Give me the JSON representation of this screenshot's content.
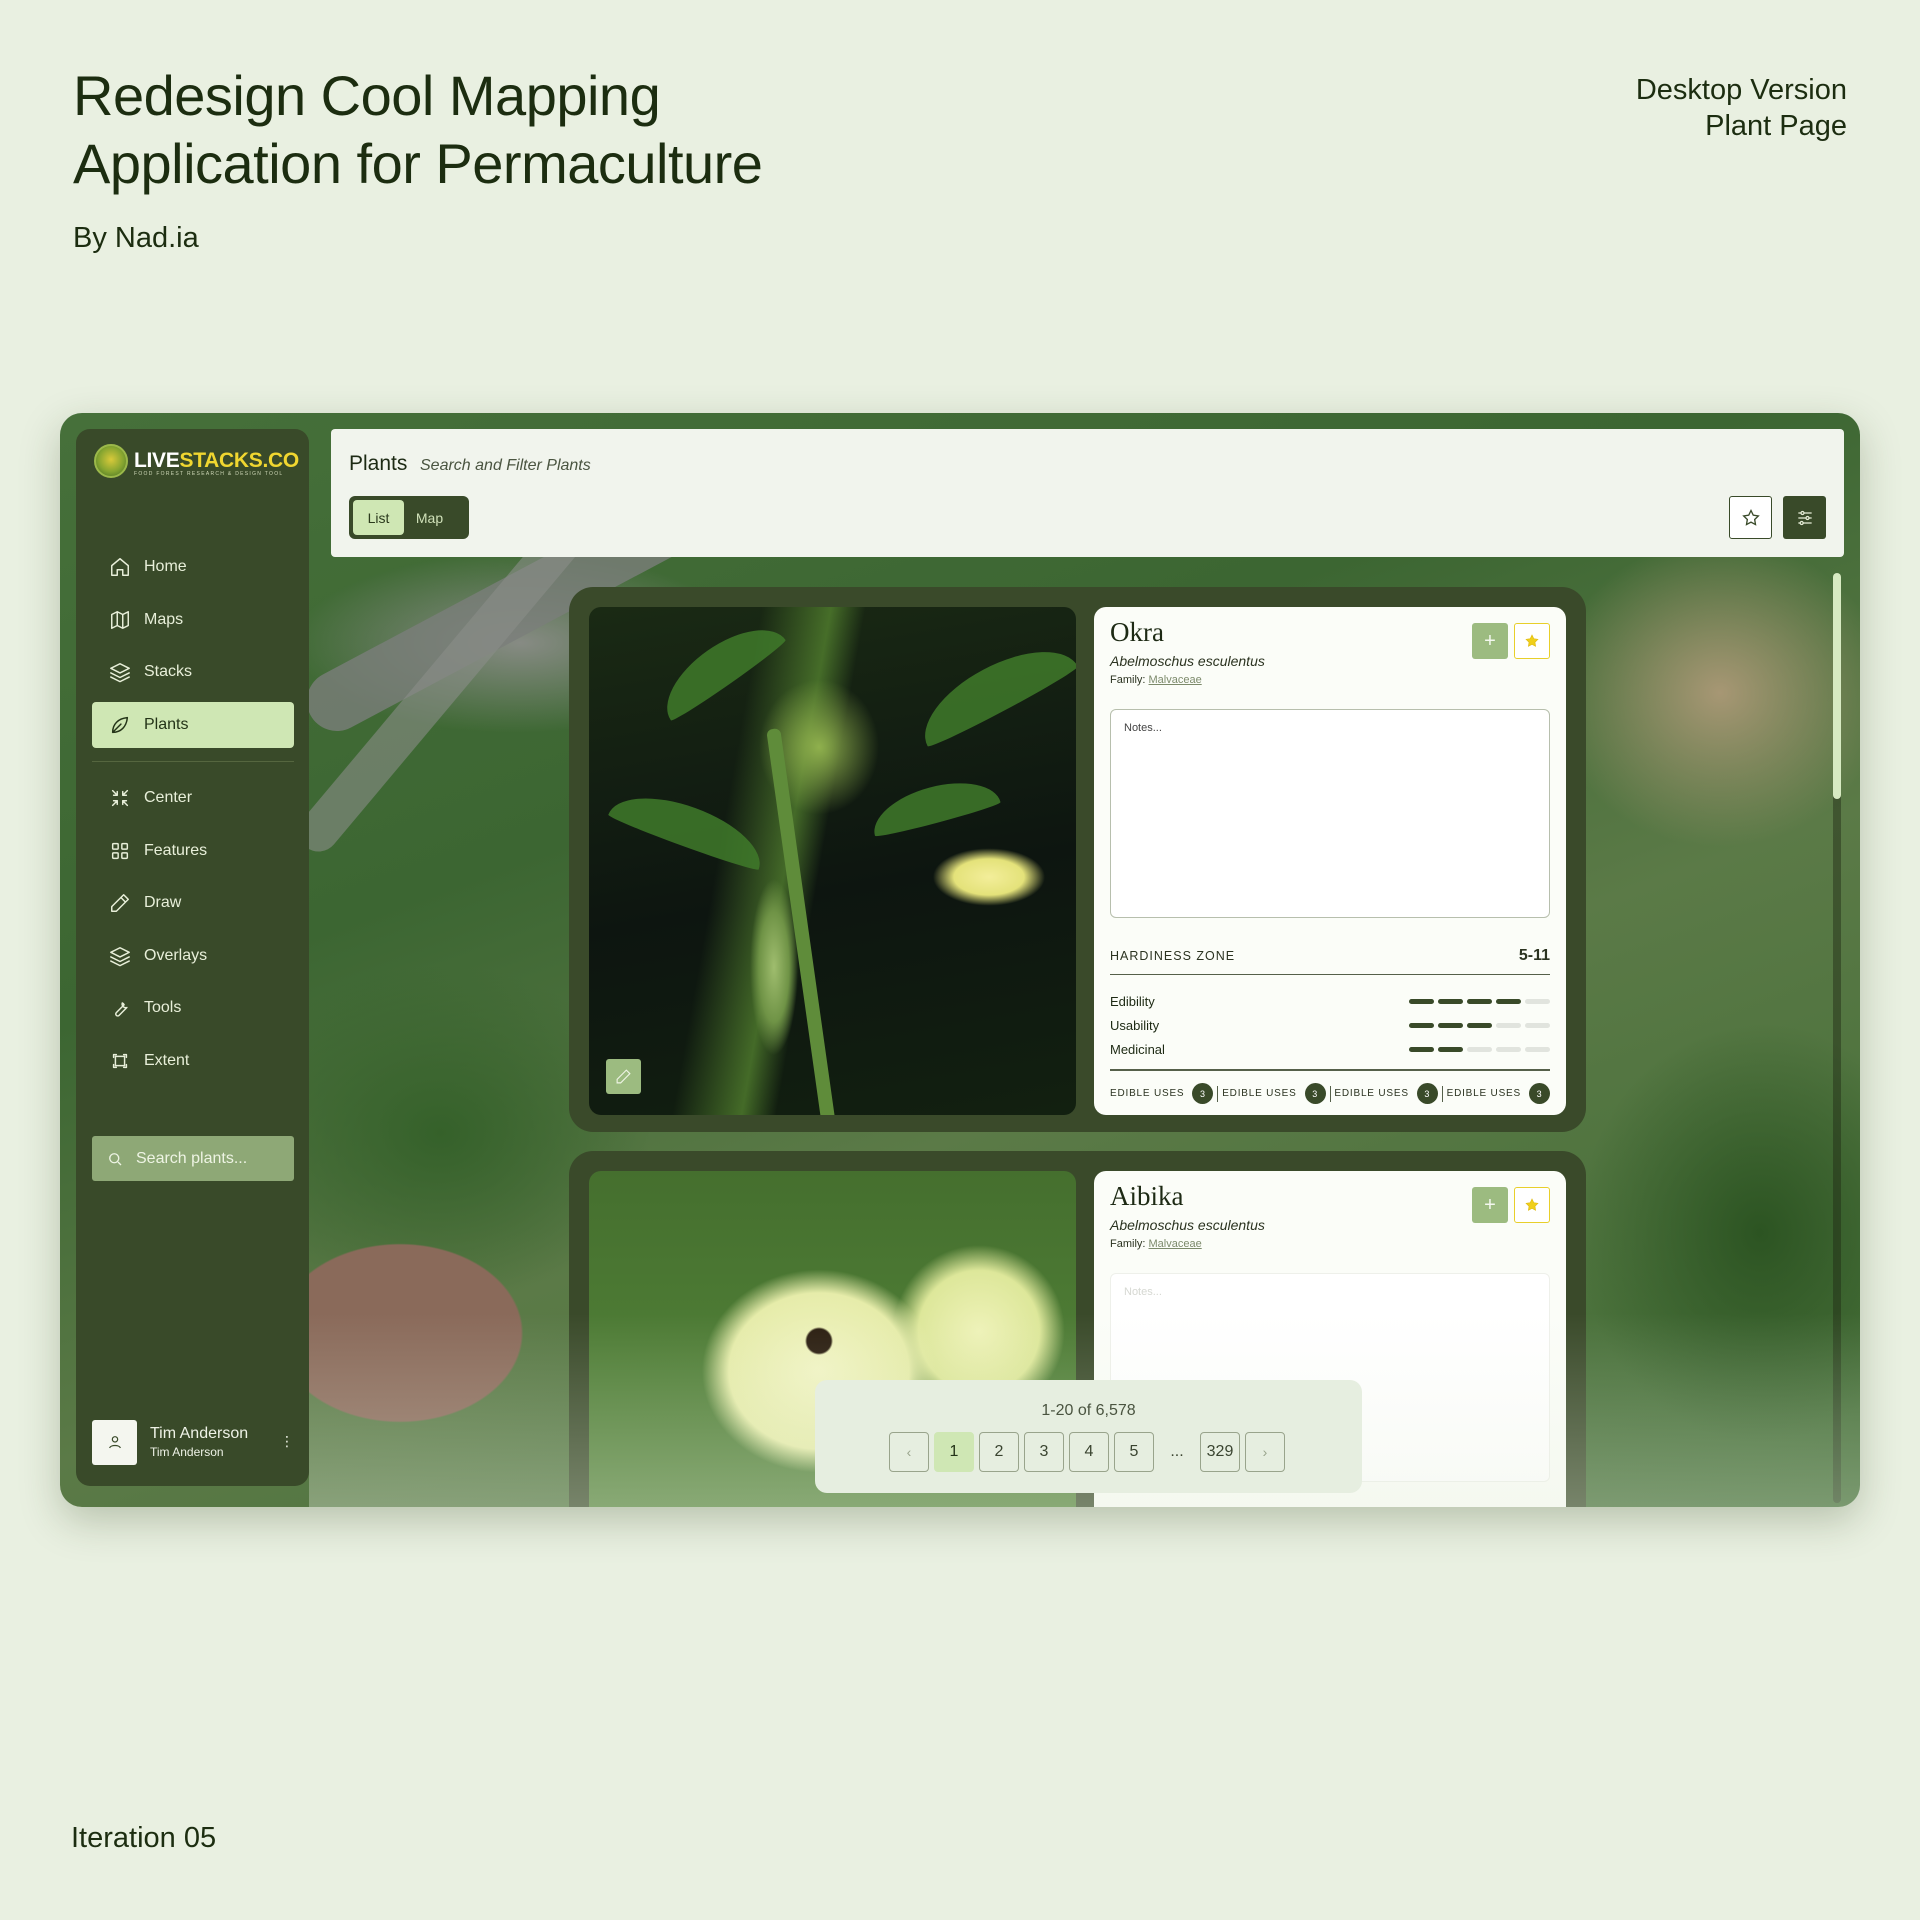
{
  "presentation": {
    "title_line1": "Redesign Cool Mapping",
    "title_line2": "Application for Permaculture",
    "author": "By Nad.ia",
    "meta_line1": "Desktop Version",
    "meta_line2": "Plant Page",
    "iteration": "Iteration 05"
  },
  "app": {
    "logo": {
      "text_a": "LIVE",
      "text_b": "STACKS.CO",
      "tagline": "FOOD FOREST RESEARCH & DESIGN TOOL"
    },
    "sidebar": {
      "group1": [
        {
          "label": "Home",
          "icon": "home-icon"
        },
        {
          "label": "Maps",
          "icon": "map-icon"
        },
        {
          "label": "Stacks",
          "icon": "layers-icon"
        },
        {
          "label": "Plants",
          "icon": "leaf-icon",
          "active": true
        }
      ],
      "group2": [
        {
          "label": "Center",
          "icon": "center-icon"
        },
        {
          "label": "Features",
          "icon": "grid-icon"
        },
        {
          "label": "Draw",
          "icon": "pencil-icon"
        },
        {
          "label": "Overlays",
          "icon": "layers-icon"
        },
        {
          "label": "Tools",
          "icon": "wrench-icon"
        },
        {
          "label": "Extent",
          "icon": "extent-icon"
        }
      ],
      "search_placeholder": "Search plants...",
      "user": {
        "name": "Tim Anderson",
        "sub": "Tim Anderson",
        "more": "⋮"
      }
    },
    "header": {
      "title": "Plants",
      "subtitle": "Search and Filter Plants",
      "toggle": {
        "list": "List",
        "map": "Map",
        "selected": "List"
      }
    },
    "plants": [
      {
        "name": "Okra",
        "latin": "Abelmoschus esculentus",
        "family_label": "Family:",
        "family": "Malvaceae",
        "notes_placeholder": "Notes...",
        "hardiness_label": "HARDINESS ZONE",
        "hardiness": "5-11",
        "ratings": [
          {
            "label": "Edibility",
            "value": 4,
            "max": 5
          },
          {
            "label": "Usability",
            "value": 3,
            "max": 5
          },
          {
            "label": "Medicinal",
            "value": 2,
            "max": 5
          }
        ],
        "uses": [
          {
            "label": "EDIBLE USES",
            "count": "3"
          },
          {
            "label": "EDIBLE USES",
            "count": "3"
          },
          {
            "label": "EDIBLE USES",
            "count": "3"
          },
          {
            "label": "EDIBLE USES",
            "count": "3"
          }
        ],
        "add": "+"
      },
      {
        "name": "Aibika",
        "latin": "Abelmoschus esculentus",
        "family_label": "Family:",
        "family": "Malvaceae",
        "notes_placeholder": "Notes...",
        "add": "+"
      }
    ],
    "pagination": {
      "info": "1-20 of 6,578",
      "prev": "‹",
      "next": "›",
      "pages": [
        "1",
        "2",
        "3",
        "4",
        "5"
      ],
      "ellipsis": "...",
      "last": "329",
      "current": "1"
    },
    "colors": {
      "sidebar": "#394a29",
      "accent": "#cfe7b4",
      "favorite": "#f0cf1a",
      "background": "#e9f0e1"
    }
  }
}
